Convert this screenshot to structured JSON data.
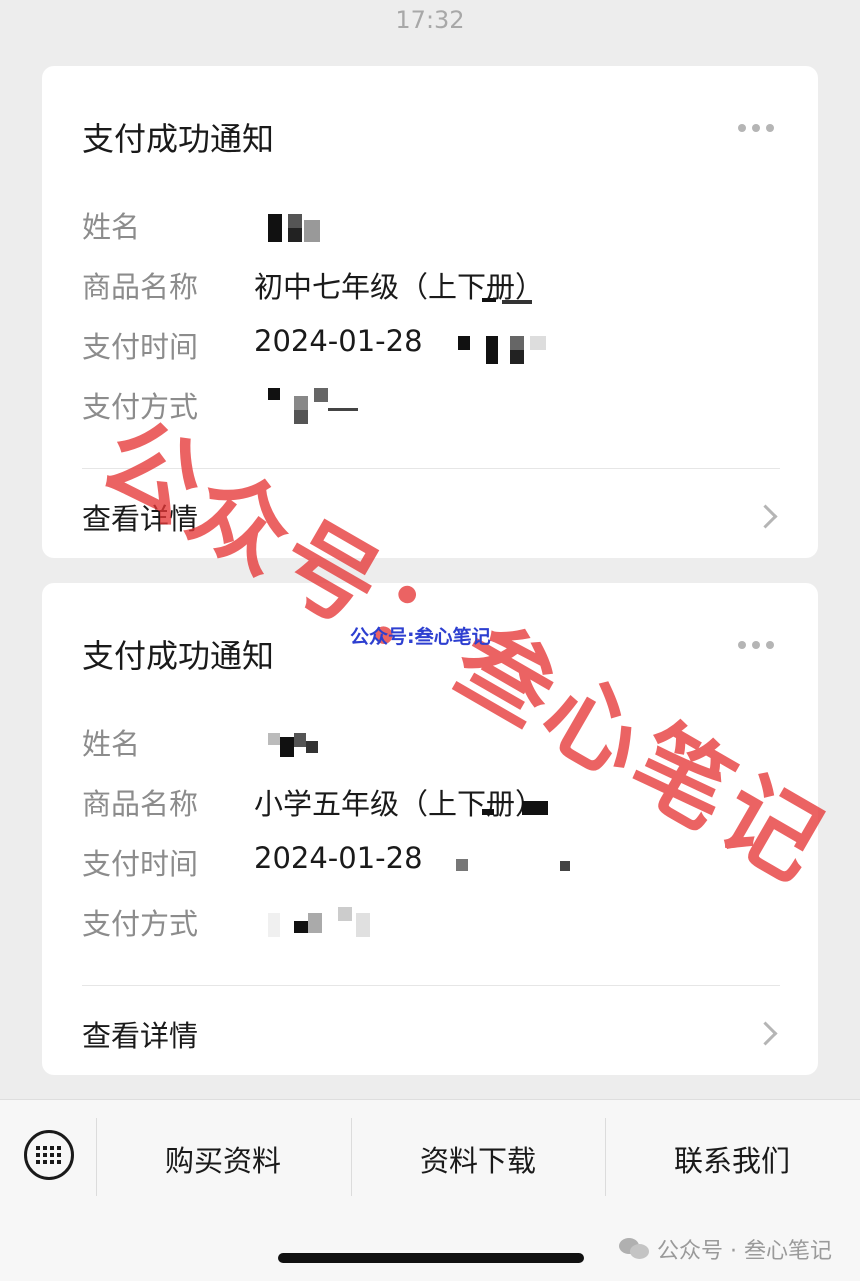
{
  "status_bar": {
    "time": "17:32"
  },
  "cards": [
    {
      "title": "支付成功通知",
      "fields": [
        {
          "label": "姓名",
          "value": ""
        },
        {
          "label": "商品名称",
          "value": "初中七年级（上下册）"
        },
        {
          "label": "支付时间",
          "value": "2024-01-28"
        },
        {
          "label": "支付方式",
          "value": ""
        }
      ],
      "details_label": "查看详情"
    },
    {
      "title": "支付成功通知",
      "fields": [
        {
          "label": "姓名",
          "value": ""
        },
        {
          "label": "商品名称",
          "value": "小学五年级（上下册）"
        },
        {
          "label": "支付时间",
          "value": "2024-01-28"
        },
        {
          "label": "支付方式",
          "value": ""
        }
      ],
      "details_label": "查看详情"
    }
  ],
  "watermarks": {
    "large": "公众号：叁心笔记",
    "small": "公众号:叁心笔记"
  },
  "bottom_menu": {
    "keyboard_icon": "keyboard-icon",
    "items": [
      "购买资料",
      "资料下载",
      "联系我们"
    ]
  },
  "footer": {
    "brand": "公众号 · 叁心笔记",
    "icon": "wechat-icon"
  },
  "colors": {
    "watermark_red": "#e63737",
    "watermark_blue": "#2d3fd0",
    "background": "#ededed"
  }
}
